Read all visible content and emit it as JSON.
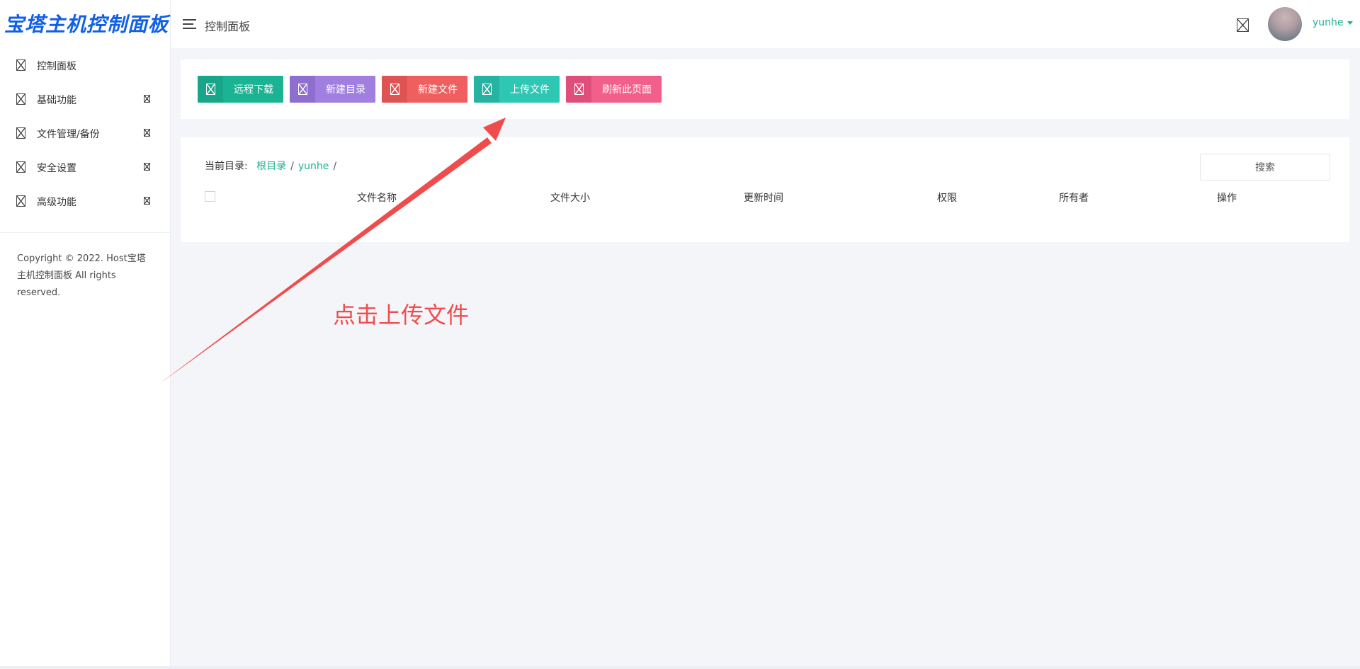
{
  "app": {
    "logo_text": "宝塔主机控制面板",
    "brand_color": "#1160e6",
    "accent_color": "#1ab394"
  },
  "header": {
    "title": "控制面板",
    "username": "yunhe",
    "menu_icon": "hamburger-icon",
    "notify_icon": "broken-image-icon"
  },
  "sidebar": {
    "items": [
      {
        "label": "控制面板",
        "icon": "broken-image-icon",
        "has_arrow": false
      },
      {
        "label": "基础功能",
        "icon": "broken-image-icon",
        "has_arrow": true
      },
      {
        "label": "文件管理/备份",
        "icon": "broken-image-icon",
        "has_arrow": true
      },
      {
        "label": "安全设置",
        "icon": "broken-image-icon",
        "has_arrow": true
      },
      {
        "label": "高级功能",
        "icon": "broken-image-icon",
        "has_arrow": true
      }
    ],
    "copyright": "Copyright © 2022. Host宝塔主机控制面板 All rights reserved."
  },
  "toolbar": {
    "buttons": [
      {
        "label": "远程下载",
        "color": "#1ab394",
        "icon_bg": "#18a689"
      },
      {
        "label": "新建目录",
        "color": "#a17fe0",
        "icon_bg": "#8e6fd0"
      },
      {
        "label": "新建文件",
        "color": "#f05f5f",
        "icon_bg": "#de5353"
      },
      {
        "label": "上传文件",
        "color": "#2ec7b4",
        "icon_bg": "#27b3a2"
      },
      {
        "label": "刷新此页面",
        "color": "#f25f8a",
        "icon_bg": "#e04f7b"
      }
    ]
  },
  "files": {
    "breadcrumb_label": "当前目录:",
    "breadcrumb": [
      "根目录",
      "yunhe"
    ],
    "search_label": "搜索",
    "columns": [
      "文件名称",
      "文件大小",
      "更新时间",
      "权限",
      "所有者",
      "操作"
    ]
  },
  "annotation": {
    "text": "点击上传文件",
    "color": "#ef4d4d"
  }
}
